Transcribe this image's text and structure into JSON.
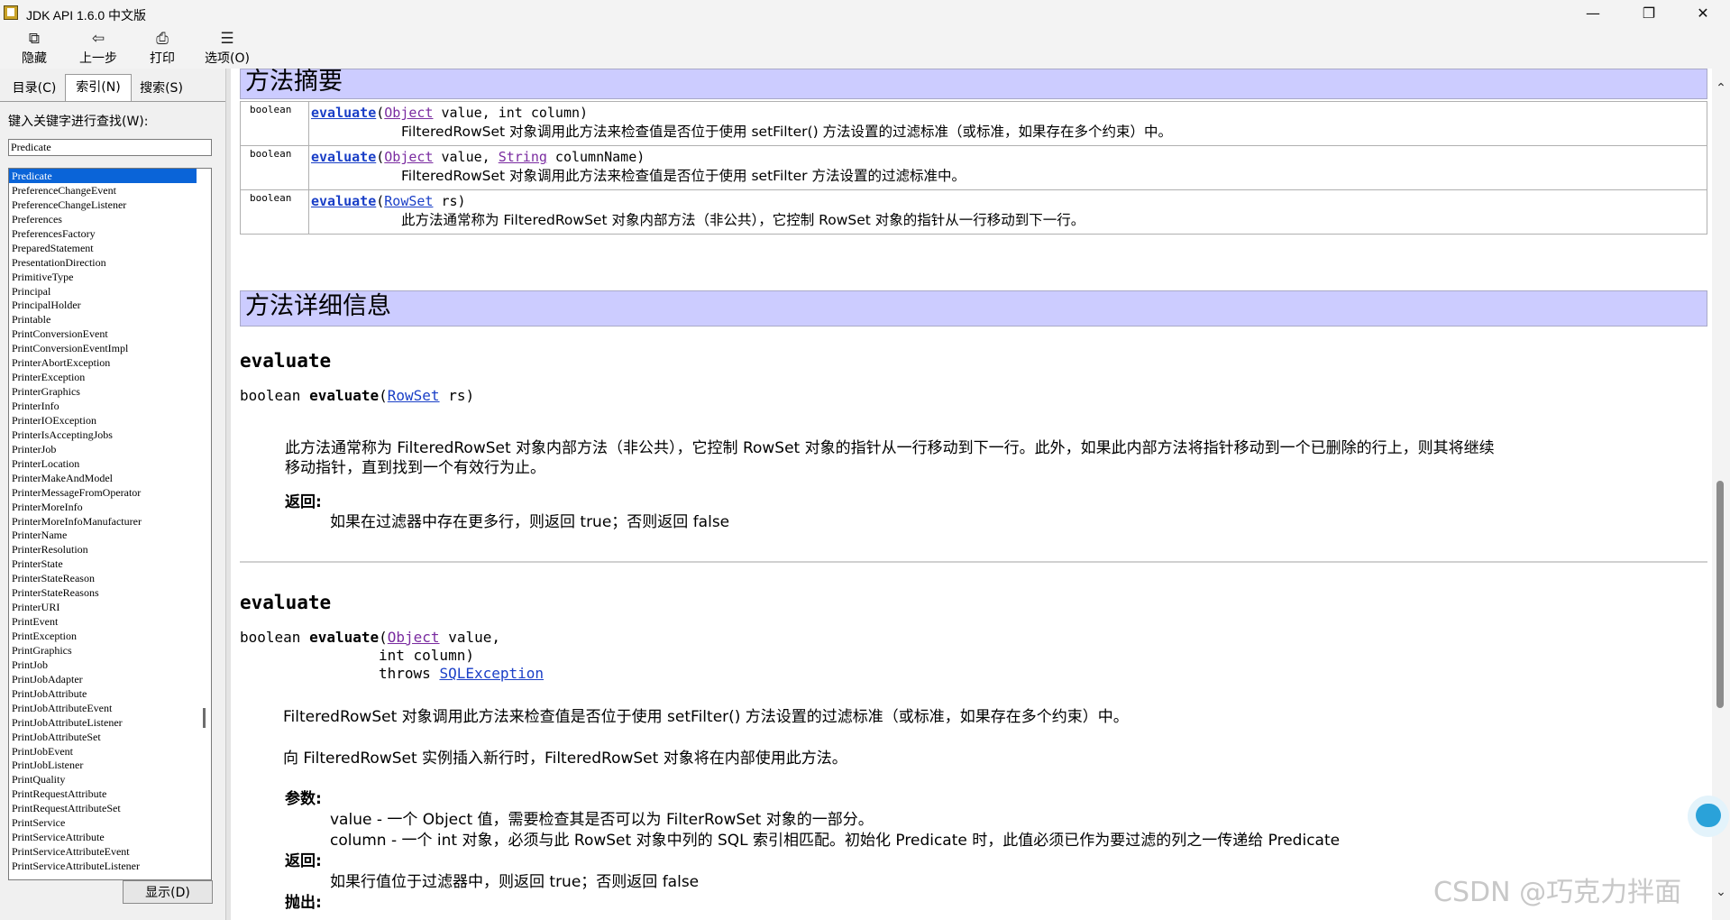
{
  "window": {
    "title": "JDK API 1.6.0 中文版",
    "minimize": "—",
    "maximize": "❐",
    "close": "✕"
  },
  "toolbar": {
    "hide": "隐藏",
    "back": "上一步",
    "print": "打印",
    "options": "选项(O)"
  },
  "left": {
    "tabs": [
      "目录(C)",
      "索引(N)",
      "搜索(S)"
    ],
    "search_label": "键入关键字进行查找(W):",
    "search_value": "Predicate",
    "show_button": "显示(D)",
    "items": [
      "Predicate",
      "PreferenceChangeEvent",
      "PreferenceChangeListener",
      "Preferences",
      "PreferencesFactory",
      "PreparedStatement",
      "PresentationDirection",
      "PrimitiveType",
      "Principal",
      "PrincipalHolder",
      "Printable",
      "PrintConversionEvent",
      "PrintConversionEventImpl",
      "PrinterAbortException",
      "PrinterException",
      "PrinterGraphics",
      "PrinterInfo",
      "PrinterIOException",
      "PrinterIsAcceptingJobs",
      "PrinterJob",
      "PrinterLocation",
      "PrinterMakeAndModel",
      "PrinterMessageFromOperator",
      "PrinterMoreInfo",
      "PrinterMoreInfoManufacturer",
      "PrinterName",
      "PrinterResolution",
      "PrinterState",
      "PrinterStateReason",
      "PrinterStateReasons",
      "PrinterURI",
      "PrintEvent",
      "PrintException",
      "PrintGraphics",
      "PrintJob",
      "PrintJobAdapter",
      "PrintJobAttribute",
      "PrintJobAttributeEvent",
      "PrintJobAttributeListener",
      "PrintJobAttributeSet",
      "PrintJobEvent",
      "PrintJobListener",
      "PrintQuality",
      "PrintRequestAttribute",
      "PrintRequestAttributeSet",
      "PrintService",
      "PrintServiceAttribute",
      "PrintServiceAttributeEvent",
      "PrintServiceAttributeListener"
    ]
  },
  "content": {
    "summary_title": "方法摘要",
    "summary_rows": [
      {
        "ret": "boolean",
        "name": "evaluate",
        "params_pre": "(",
        "type1": "Object",
        "p1": " value, int column)",
        "type2": "",
        "p2": "",
        "desc": "FilteredRowSet 对象调用此方法来检查值是否位于使用 setFilter() 方法设置的过滤标准（或标准，如果存在多个约束）中。"
      },
      {
        "ret": "boolean",
        "name": "evaluate",
        "params_pre": "(",
        "type1": "Object",
        "p1": " value, ",
        "type2": "String",
        "p2": " columnName)",
        "desc": "FilteredRowSet 对象调用此方法来检查值是否位于使用 setFilter 方法设置的过滤标准中。"
      },
      {
        "ret": "boolean",
        "name": "evaluate",
        "params_pre": "(",
        "type1": "RowSet",
        "p1": " rs)",
        "type2": "",
        "p2": "",
        "desc": " 此方法通常称为 FilteredRowSet 对象内部方法（非公共），它控制 RowSet 对象的指针从一行移动到下一行。"
      }
    ],
    "detail_title": "方法详细信息",
    "m1": {
      "heading": "evaluate",
      "sig_pre": "boolean ",
      "sig_name": "evaluate",
      "sig_open": "(",
      "sig_type": "RowSet",
      "sig_rest": " rs)",
      "desc_line1": "此方法通常称为 FilteredRowSet 对象内部方法（非公共），它控制 RowSet 对象的指针从一行移动到下一行。此外，如果此内部方法将指针移动到一个已删除的行上，则其将继续",
      "desc_line2": "移动指针，直到找到一个有效行为止。",
      "returns_label": "返回:",
      "returns_text": "如果在过滤器中存在更多行，则返回 true；否则返回 false"
    },
    "m2": {
      "heading": "evaluate",
      "sig_pre": "boolean ",
      "sig_name": "evaluate",
      "sig_open": "(",
      "sig_type": "Object",
      "sig_rest": " value,",
      "sig_line2": "int column)",
      "sig_throws": "throws ",
      "sig_exc": "SQLException",
      "desc1": "FilteredRowSet 对象调用此方法来检查值是否位于使用 setFilter() 方法设置的过滤标准（或标准，如果存在多个约束）中。",
      "desc2": "向 FilteredRowSet 实例插入新行时，FilteredRowSet 对象将在内部使用此方法。",
      "params_label": "参数:",
      "param1": "value - 一个 Object 值，需要检查其是否可以为 FilterRowSet 对象的一部分。",
      "param2": "column - 一个 int 对象，必须与此 RowSet 对象中列的 SQL 索引相匹配。初始化 Predicate 时，此值必须已作为要过滤的列之一传递给 Predicate",
      "returns_label": "返回:",
      "returns_text": "如果行值位于过滤器中，则返回 true；否则返回 false",
      "throws_label": "抛出:"
    }
  },
  "watermark": "CSDN @巧克力拌面"
}
